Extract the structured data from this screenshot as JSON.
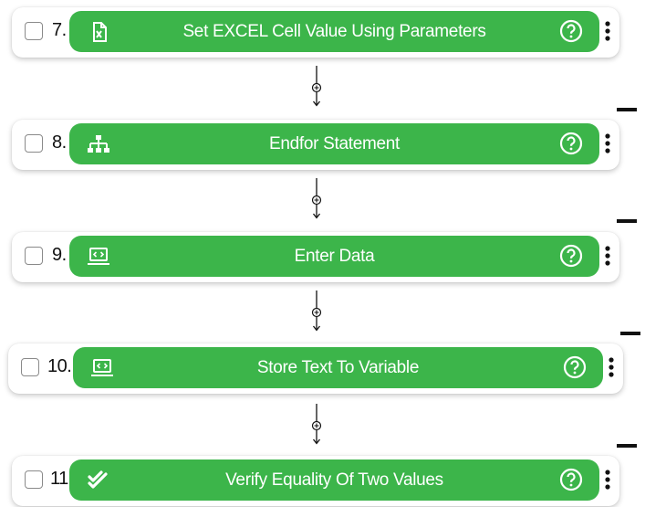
{
  "steps": [
    {
      "number": "7.",
      "label": "Set EXCEL Cell Value Using Parameters",
      "icon": "excel-icon"
    },
    {
      "number": "8.",
      "label": "Endfor Statement",
      "icon": "flowchart-icon"
    },
    {
      "number": "9.",
      "label": "Enter Data",
      "icon": "laptop-code-icon"
    },
    {
      "number": "10.",
      "label": "Store Text To Variable",
      "icon": "laptop-code-icon"
    },
    {
      "number": "11.",
      "label": "Verify Equality Of Two Values",
      "icon": "double-check-icon"
    }
  ],
  "colors": {
    "accent": "#3cb54a",
    "text": "#111111",
    "on_accent": "#ffffff"
  }
}
